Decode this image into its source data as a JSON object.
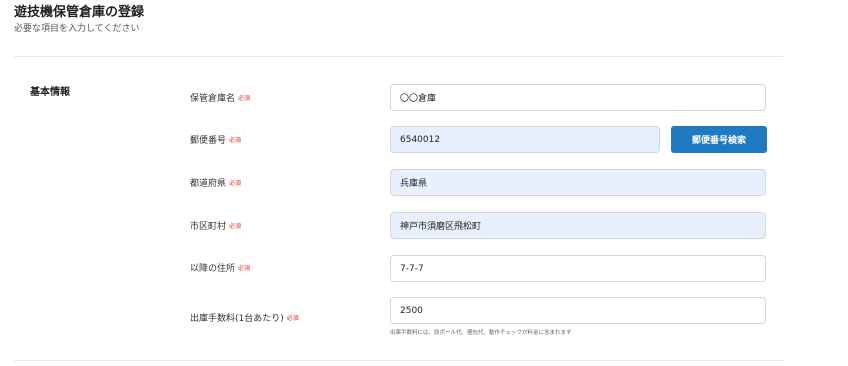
{
  "header": {
    "title": "遊技機保管倉庫の登録",
    "subtitle": "必要な項目を入力してください"
  },
  "section": {
    "title": "基本情報"
  },
  "required_mark": "必須",
  "fields": {
    "warehouse_name": {
      "label": "保管倉庫名",
      "value": "〇〇倉庫"
    },
    "postal_code": {
      "label": "郵便番号",
      "value": "6540012"
    },
    "prefecture": {
      "label": "都道府県",
      "value": "兵庫県"
    },
    "city": {
      "label": "市区町村",
      "value": "神戸市須磨区飛松町"
    },
    "address_rest": {
      "label": "以降の住所",
      "value": "7-7-7"
    },
    "shipping_fee": {
      "label": "出庫手数料(1台あたり)",
      "value": "2500",
      "help": "出庫手数料には、段ボール代、梱包代、動作チェックが料金に含まれます"
    }
  },
  "buttons": {
    "postal_search": "郵便番号検索"
  },
  "colors": {
    "primary_button": "#1f7ac2",
    "required": "#e0302a",
    "autofill_bg": "#e8f0fe"
  }
}
